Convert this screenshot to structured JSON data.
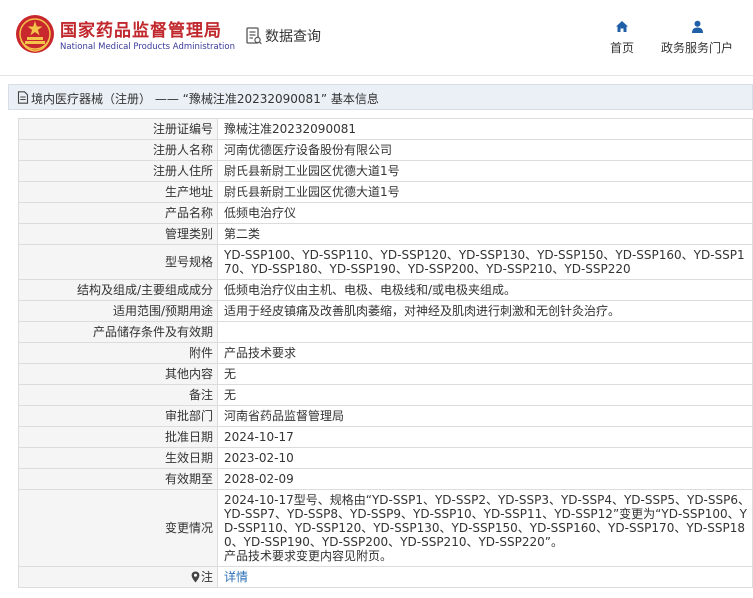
{
  "header": {
    "brand_cn": "国家药品监督管理局",
    "brand_en": "National Medical Products Administration",
    "query_title": "数据查询",
    "nav": [
      {
        "label": "首页",
        "icon": "home-icon"
      },
      {
        "label": "政务服务门户",
        "icon": "user-icon"
      }
    ]
  },
  "title_bar": {
    "text": "境内医疗器械（注册） —— “豫械注准20232090081” 基本信息",
    "icon": "document-icon"
  },
  "rows": [
    {
      "label": "注册证编号",
      "value": "豫械注准20232090081"
    },
    {
      "label": "注册人名称",
      "value": "河南优德医疗设备股份有限公司"
    },
    {
      "label": "注册人住所",
      "value": "尉氏县新尉工业园区优德大道1号"
    },
    {
      "label": "生产地址",
      "value": "尉氏县新尉工业园区优德大道1号"
    },
    {
      "label": "产品名称",
      "value": "低频电治疗仪"
    },
    {
      "label": "管理类别",
      "value": "第二类"
    },
    {
      "label": "型号规格",
      "value": "YD-SSP100、YD-SSP110、YD-SSP120、YD-SSP130、YD-SSP150、YD-SSP160、YD-SSP170、YD-SSP180、YD-SSP190、YD-SSP200、YD-SSP210、YD-SSP220"
    },
    {
      "label": "结构及组成/主要组成成分",
      "value": "低频电治疗仪由主机、电极、电极线和/或电极夹组成。"
    },
    {
      "label": "适用范围/预期用途",
      "value": "适用于经皮镇痛及改善肌肉萎缩，对神经及肌肉进行刺激和无创针灸治疗。"
    },
    {
      "label": "产品储存条件及有效期",
      "value": ""
    },
    {
      "label": "附件",
      "value": "产品技术要求"
    },
    {
      "label": "其他内容",
      "value": "无"
    },
    {
      "label": "备注",
      "value": "无"
    },
    {
      "label": "审批部门",
      "value": "河南省药品监督管理局"
    },
    {
      "label": "批准日期",
      "value": "2024-10-17"
    },
    {
      "label": "生效日期",
      "value": "2023-02-10"
    },
    {
      "label": "有效期至",
      "value": "2028-02-09"
    },
    {
      "label": "变更情况",
      "value": "2024-10-17型号、规格由“YD-SSP1、YD-SSP2、YD-SSP3、YD-SSP4、YD-SSP5、YD-SSP6、YD-SSP7、YD-SSP8、YD-SSP9、YD-SSP10、YD-SSP11、YD-SSP12”变更为“YD-SSP100、YD-SSP110、YD-SSP120、YD-SSP130、YD-SSP150、YD-SSP160、YD-SSP170、YD-SSP180、YD-SSP190、YD-SSP200、YD-SSP210、YD-SSP220”。",
      "value2": "产品技术要求变更内容见附页。"
    }
  ],
  "note_row": {
    "label": "注",
    "link": "详情",
    "icon": "pin-icon"
  },
  "colors": {
    "brand": "#c0282d",
    "link": "#2a6fb8",
    "title_bar_bg": "#eaf0f6",
    "label_bg": "#f5f5f5"
  }
}
